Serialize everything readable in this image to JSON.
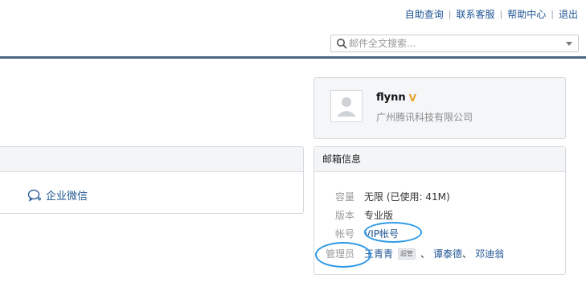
{
  "top_links": [
    "自助查询",
    "联系客服",
    "帮助中心",
    "退出"
  ],
  "top_sep": "|",
  "search": {
    "placeholder": "邮件全文搜索..."
  },
  "left_panel": {
    "wechat_label": "企业微信"
  },
  "profile": {
    "name": "flynn",
    "vip_mark": "V",
    "company": "广州腾讯科技有限公司"
  },
  "mailbox": {
    "title": "邮箱信息",
    "capacity_label": "容量",
    "capacity_value": "无限 (已使用: 41M)",
    "edition_label": "版本",
    "edition_value": "专业版",
    "account_label": "帐号",
    "account_value": "VIP帐号",
    "admin_label": "管理员",
    "admins": [
      "王青青",
      "谭泰德",
      "邓迪翁"
    ],
    "super_badge": "超管",
    "admin_sep": "、"
  },
  "colors": {
    "link": "#1e5494",
    "rule": "#4a6683",
    "vip": "#e8a12a",
    "highlight": "#2f9ae6"
  }
}
